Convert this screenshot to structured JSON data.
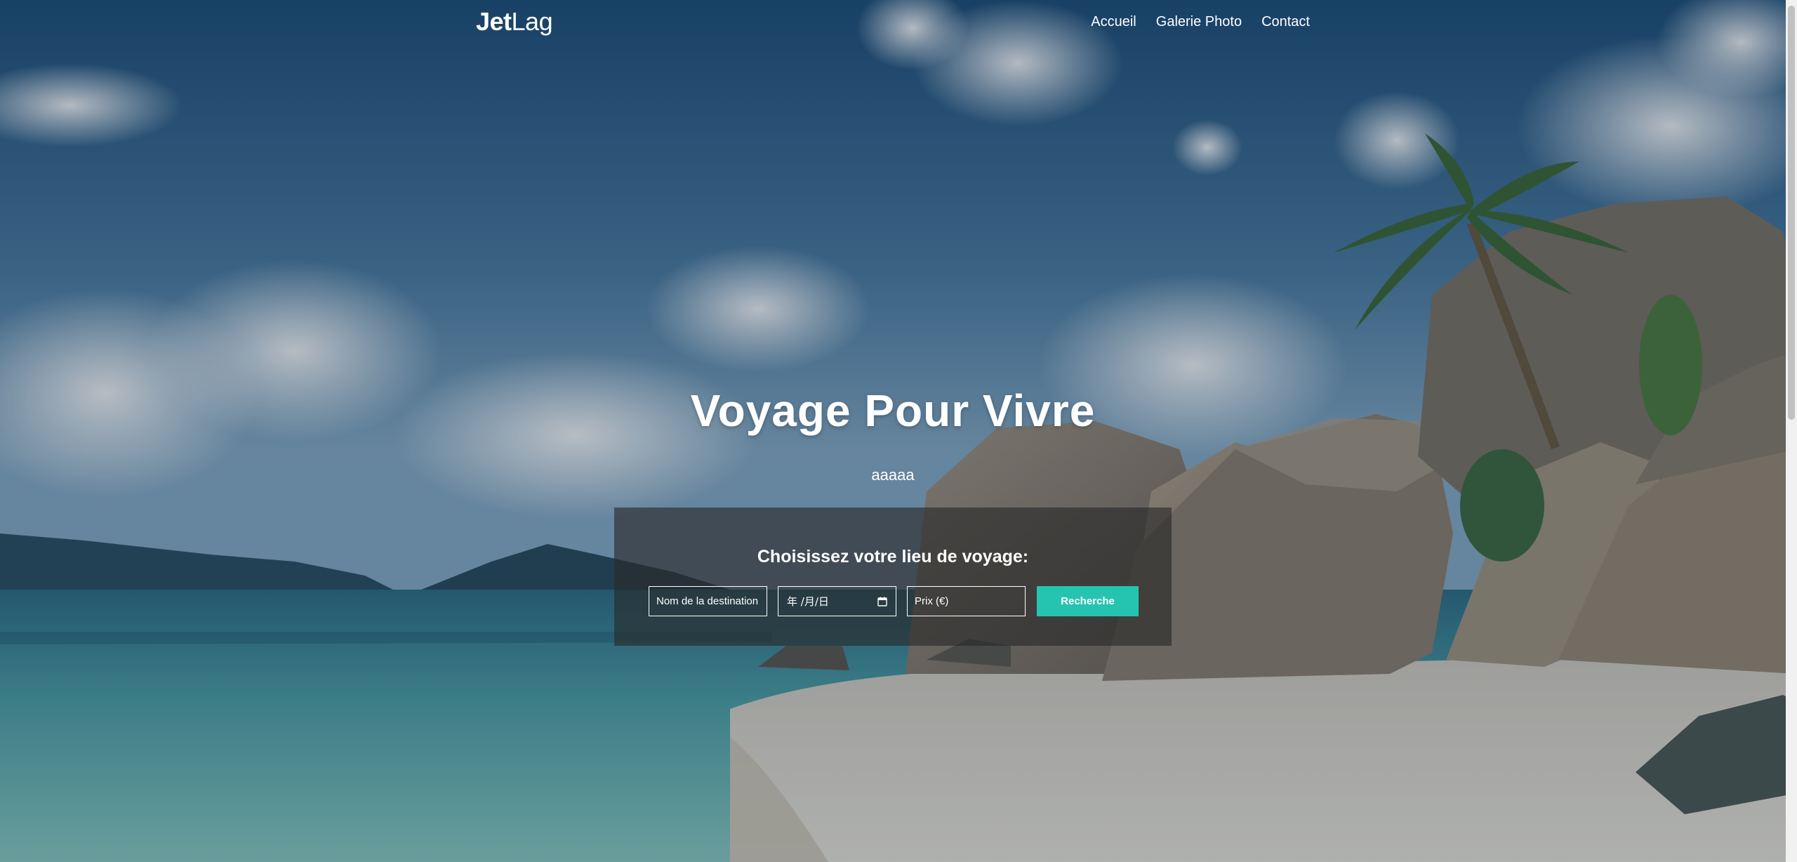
{
  "brand": {
    "part1": "Jet",
    "part2": "Lag"
  },
  "nav": {
    "items": [
      {
        "label": "Accueil"
      },
      {
        "label": "Galerie Photo"
      },
      {
        "label": "Contact"
      }
    ]
  },
  "hero": {
    "title": "Voyage Pour Vivre",
    "subtitle": "aaaaa"
  },
  "search": {
    "heading": "Choisissez votre lieu de voyage:",
    "destination_placeholder": "Nom de la destination",
    "date_placeholder": "年 /月/日",
    "price_placeholder": "Prix (€)",
    "button_label": "Recherche"
  },
  "colors": {
    "accent": "#25c4b0",
    "panel": "#282828"
  },
  "icons": {
    "date": "calendar-icon"
  }
}
